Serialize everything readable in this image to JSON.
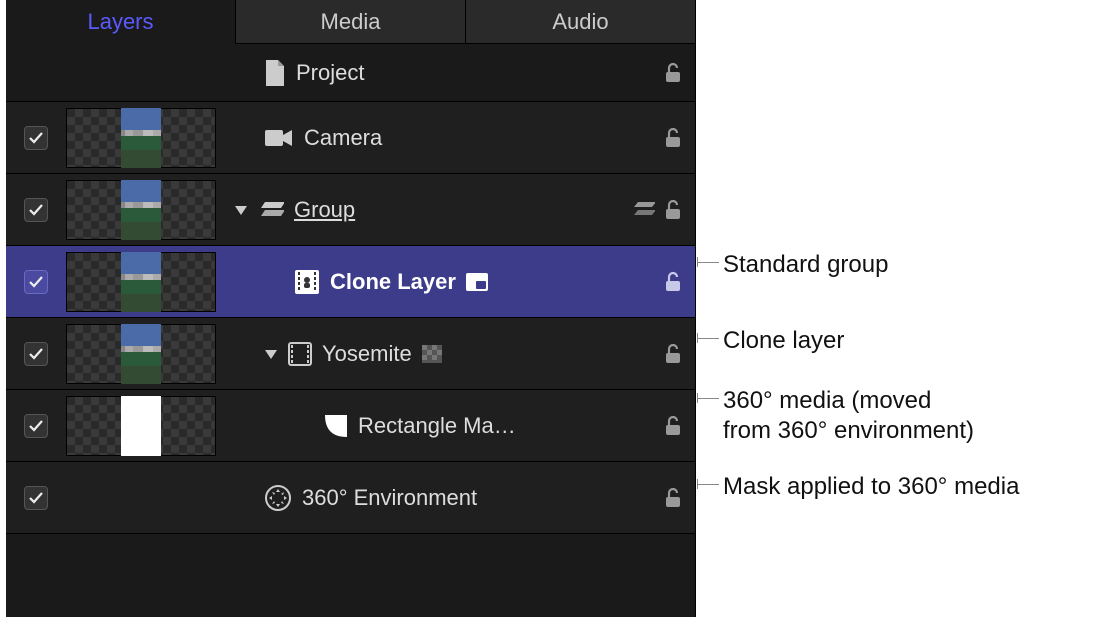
{
  "tabs": {
    "layers": "Layers",
    "media": "Media",
    "audio": "Audio"
  },
  "rows": {
    "project": {
      "label": "Project"
    },
    "camera": {
      "label": "Camera"
    },
    "group": {
      "label": "Group"
    },
    "clone": {
      "label": "Clone Layer"
    },
    "yosemite": {
      "label": "Yosemite"
    },
    "rectmask": {
      "label": "Rectangle Ma…"
    },
    "env360": {
      "label": "360° Environment"
    }
  },
  "annotations": {
    "standard_group": "Standard group",
    "clone_layer": "Clone layer",
    "media360_l1": "360° media (moved",
    "media360_l2": "from 360° environment)",
    "mask_applied": "Mask applied to 360° media"
  }
}
